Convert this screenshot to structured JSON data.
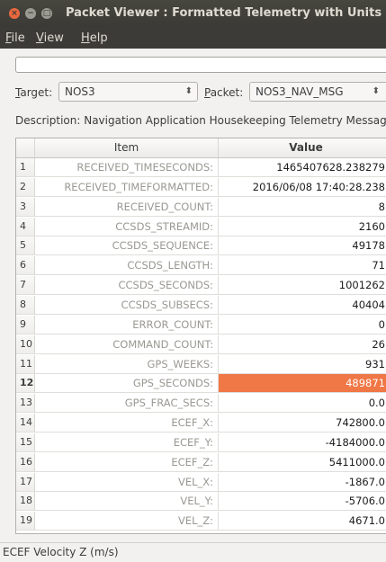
{
  "window": {
    "title": "Packet Viewer : Formatted Telemetry with Units"
  },
  "menu": {
    "file": "File",
    "view": "View",
    "help": "Help"
  },
  "toolbar": {
    "search_value": ""
  },
  "selectors": {
    "target_label": "Target:",
    "target_value": "NOS3",
    "packet_label": "Packet:",
    "packet_value": "NOS3_NAV_MSG"
  },
  "description": {
    "label": "Description:",
    "text": "Navigation Application Housekeeping Telemetry Message"
  },
  "table": {
    "headers": {
      "item": "Item",
      "value": "Value"
    },
    "rows": [
      {
        "num": "1",
        "item": "RECEIVED_TIMESECONDS:",
        "value": "1465407628.238279"
      },
      {
        "num": "2",
        "item": "RECEIVED_TIMEFORMATTED:",
        "value": "2016/06/08 17:40:28.238"
      },
      {
        "num": "3",
        "item": "RECEIVED_COUNT:",
        "value": "8"
      },
      {
        "num": "4",
        "item": "CCSDS_STREAMID:",
        "value": "2160"
      },
      {
        "num": "5",
        "item": "CCSDS_SEQUENCE:",
        "value": "49178"
      },
      {
        "num": "6",
        "item": "CCSDS_LENGTH:",
        "value": "71"
      },
      {
        "num": "7",
        "item": "CCSDS_SECONDS:",
        "value": "1001262"
      },
      {
        "num": "8",
        "item": "CCSDS_SUBSECS:",
        "value": "40404"
      },
      {
        "num": "9",
        "item": "ERROR_COUNT:",
        "value": "0"
      },
      {
        "num": "10",
        "item": "COMMAND_COUNT:",
        "value": "26"
      },
      {
        "num": "11",
        "item": "GPS_WEEKS:",
        "value": "931"
      },
      {
        "num": "12",
        "item": "GPS_SECONDS:",
        "value": "489871"
      },
      {
        "num": "13",
        "item": "GPS_FRAC_SECS:",
        "value": "0.0"
      },
      {
        "num": "14",
        "item": "ECEF_X:",
        "value": "742800.0"
      },
      {
        "num": "15",
        "item": "ECEF_Y:",
        "value": "-4184000.0"
      },
      {
        "num": "16",
        "item": "ECEF_Z:",
        "value": "5411000.0"
      },
      {
        "num": "17",
        "item": "VEL_X:",
        "value": "-1867.0"
      },
      {
        "num": "18",
        "item": "VEL_Y:",
        "value": "-5706.0"
      },
      {
        "num": "19",
        "item": "VEL_Z:",
        "value": "4671.0"
      }
    ]
  },
  "status": {
    "text": "ECEF Velocity Z (m/s)"
  },
  "colors": {
    "selection": "#f07746",
    "titlebar": "#3c3b37"
  }
}
